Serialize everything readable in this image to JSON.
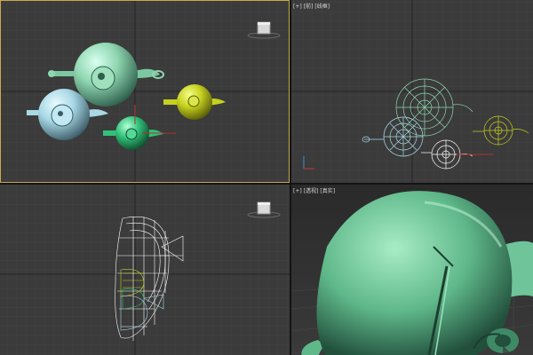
{
  "viewports": {
    "top": {
      "labels": []
    },
    "front": {
      "labels": [
        "[+]",
        "[前]",
        "[线框]"
      ]
    },
    "left": {
      "labels": []
    },
    "perspective": {
      "labels": [
        "[+]",
        "[透视]",
        "[真实]"
      ]
    }
  },
  "colors": {
    "viewport_bg": "#3b3b3b",
    "grid_minor": "#474747",
    "grid_major": "#272727",
    "active_border": "#c8a94a",
    "teapot_big": "#8fd6b0",
    "teapot_blue": "#a8d8e6",
    "teapot_yellow": "#c6d11e",
    "teapot_green": "#31c27a",
    "teapot_white": "#ffffff"
  },
  "icons": [
    "viewcube-icon",
    "axis-tripod-icon"
  ]
}
